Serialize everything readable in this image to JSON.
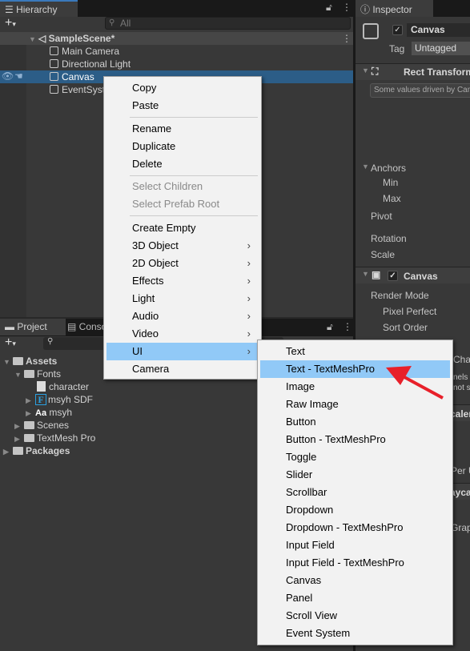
{
  "hierarchy": {
    "tab": "Hierarchy",
    "search_placeholder": "All",
    "scene": "SampleScene*",
    "items": [
      "Main Camera",
      "Directional Light",
      "Canvas",
      "EventSystem"
    ]
  },
  "context_menu": {
    "items": [
      "Copy",
      "Paste",
      "Rename",
      "Duplicate",
      "Delete",
      "Select Children",
      "Select Prefab Root",
      "Create Empty",
      "3D Object",
      "2D Object",
      "Effects",
      "Light",
      "Audio",
      "Video",
      "UI",
      "Camera"
    ]
  },
  "ui_submenu": {
    "items": [
      "Text",
      "Text - TextMeshPro",
      "Image",
      "Raw Image",
      "Button",
      "Button - TextMeshPro",
      "Toggle",
      "Slider",
      "Scrollbar",
      "Dropdown",
      "Dropdown - TextMeshPro",
      "Input Field",
      "Input Field - TextMeshPro",
      "Canvas",
      "Panel",
      "Scroll View",
      "Event System"
    ],
    "highlighted": "Text - TextMeshPro"
  },
  "project": {
    "tab": "Project",
    "tab2": "Console",
    "tree": [
      "Assets",
      "Fonts",
      "character",
      "msyh SDF",
      "msyh",
      "Scenes",
      "TextMesh Pro",
      "Packages"
    ],
    "font_asset_glyph": "F",
    "font_glyph": "Aa"
  },
  "inspector": {
    "tab": "Inspector",
    "object_name": "Canvas",
    "tag_label": "Tag",
    "tag_value": "Untagged",
    "rect_transform": "Rect Transform",
    "help": "Some values driven by Canvas",
    "anchors": "Anchors",
    "min": "Min",
    "max": "Max",
    "pivot": "Pivot",
    "rotation": "Rotation",
    "scale": "Scale",
    "canvas": "Canvas",
    "render_mode": "Render Mode",
    "pixel_perfect": "Pixel Perfect",
    "sort_order": "Sort Order",
    "partial": [
      "Cha",
      "nels N",
      "not s",
      "caler",
      "Per U",
      "ayca",
      "Graph"
    ]
  },
  "colors": {
    "selection": "#2c5d87",
    "menu_highlight": "#91c9f7",
    "arrow": "#e8202a"
  }
}
